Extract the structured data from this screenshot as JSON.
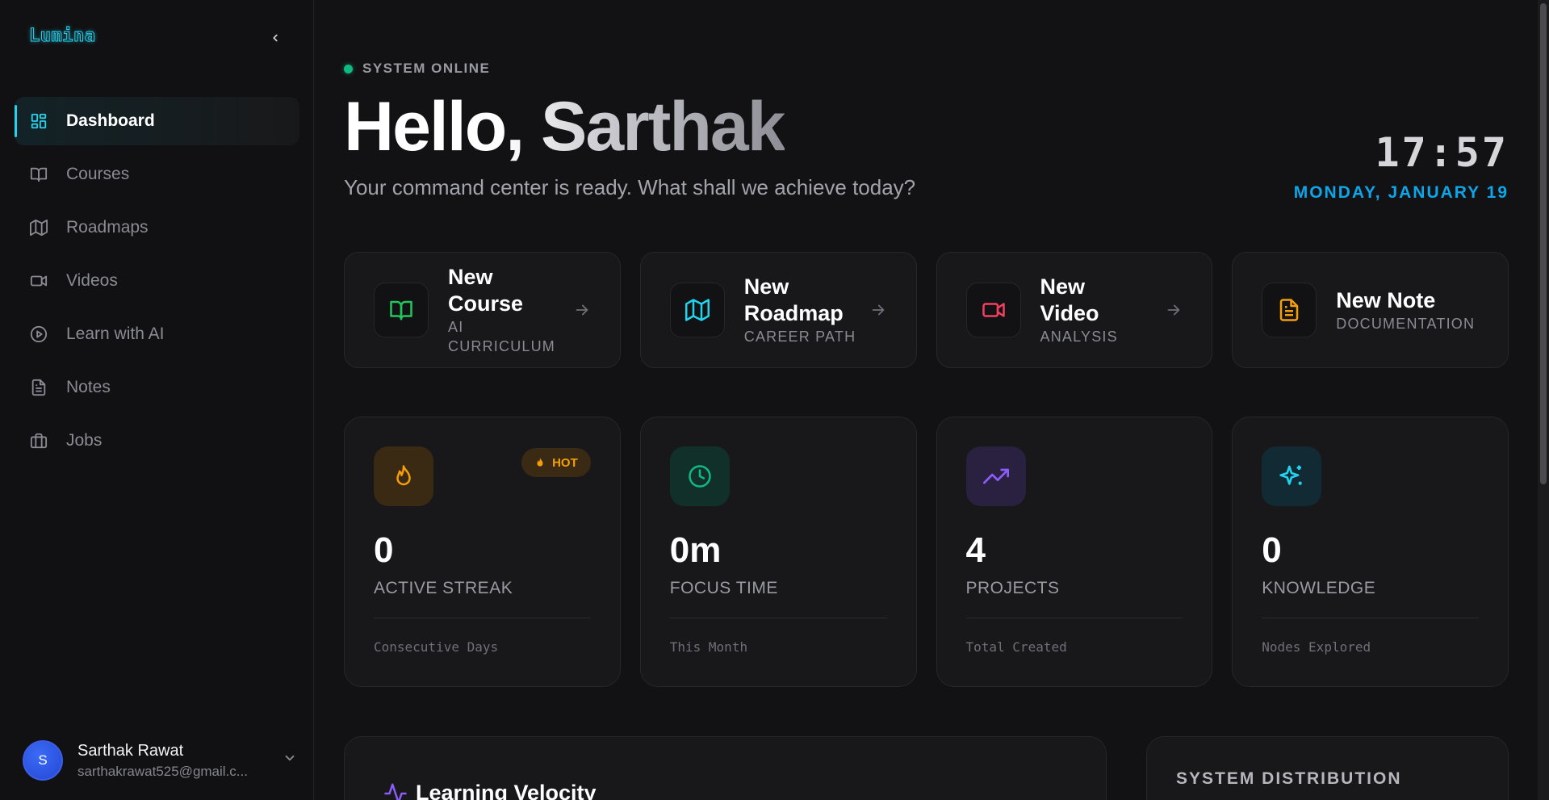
{
  "app": {
    "logo": "Lumina"
  },
  "sidebar": {
    "items": [
      {
        "label": "Dashboard",
        "icon": "dashboard-icon",
        "active": true
      },
      {
        "label": "Courses",
        "icon": "book-icon"
      },
      {
        "label": "Roadmaps",
        "icon": "map-icon"
      },
      {
        "label": "Videos",
        "icon": "video-icon"
      },
      {
        "label": "Learn with AI",
        "icon": "play-circle-icon"
      },
      {
        "label": "Notes",
        "icon": "file-text-icon"
      },
      {
        "label": "Jobs",
        "icon": "briefcase-icon"
      }
    ],
    "user": {
      "initial": "S",
      "name": "Sarthak Rawat",
      "email": "sarthakrawat525@gmail.c..."
    }
  },
  "header": {
    "status": "SYSTEM ONLINE",
    "greeting": "Hello, Sarthak",
    "subtitle": "Your command center is ready. What shall we achieve today?",
    "time": "17:57",
    "date": "MONDAY, JANUARY 19"
  },
  "actions": [
    {
      "title": "New Course",
      "subtitle": "AI CURRICULUM",
      "icon": "book-open-icon",
      "color": "#22c55e"
    },
    {
      "title": "New Roadmap",
      "subtitle": "CAREER PATH",
      "icon": "map-icon",
      "color": "#22d3ee"
    },
    {
      "title": "New Video",
      "subtitle": "ANALYSIS",
      "icon": "video-icon",
      "color": "#f43f5e"
    },
    {
      "title": "New Note",
      "subtitle": "DOCUMENTATION",
      "icon": "file-text-icon",
      "color": "#f59e0b"
    }
  ],
  "stats": [
    {
      "value": "0",
      "label": "ACTIVE STREAK",
      "note": "Consecutive Days",
      "icon": "flame-icon",
      "color": "#f59e0b",
      "badge": "HOT"
    },
    {
      "value": "0m",
      "label": "FOCUS TIME",
      "note": "This Month",
      "icon": "clock-icon",
      "color": "#10b981"
    },
    {
      "value": "4",
      "label": "PROJECTS",
      "note": "Total Created",
      "icon": "trending-up-icon",
      "color": "#8b5cf6"
    },
    {
      "value": "0",
      "label": "KNOWLEDGE",
      "note": "Nodes Explored",
      "icon": "sparkles-icon",
      "color": "#22d3ee"
    }
  ],
  "panels": {
    "velocity_title": "Learning Velocity",
    "distribution_title": "SYSTEM DISTRIBUTION"
  }
}
